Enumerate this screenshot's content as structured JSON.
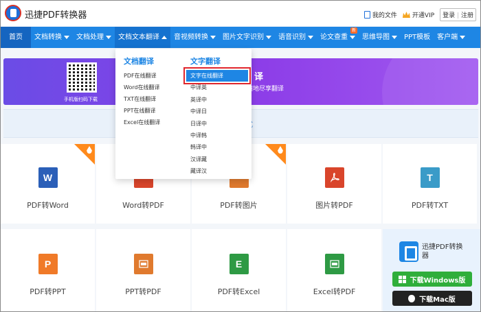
{
  "header": {
    "brand": "迅捷PDF转换器",
    "my_files": "我的文件",
    "vip": "开通VIP",
    "login": "登录",
    "separator": "|",
    "register": "注册"
  },
  "nav": {
    "items": [
      {
        "label": "首页"
      },
      {
        "label": "文档转换"
      },
      {
        "label": "文档处理"
      },
      {
        "label": "文档文本翻译"
      },
      {
        "label": "音视频转换"
      },
      {
        "label": "图片文字识别"
      },
      {
        "label": "语音识别"
      },
      {
        "label": "论文查重",
        "badge": "新"
      },
      {
        "label": "思维导图"
      },
      {
        "label": "PPT模板"
      },
      {
        "label": "客户端"
      }
    ]
  },
  "banner": {
    "qr_caption": "手机版扫码下载",
    "title_fragment": "译",
    "subtitle_fragment": "时随地尽享翻译"
  },
  "strip": {
    "text_fragment": "格式"
  },
  "dropdown": {
    "left_title": "文档翻译",
    "left_items": [
      "PDF在线翻译",
      "Word在线翻译",
      "TXT在线翻译",
      "PPT在线翻译",
      "Excel在线翻译"
    ],
    "right_title": "文字翻译",
    "right_items": [
      "文字在线翻译",
      "中译英",
      "英译中",
      "中译日",
      "日译中",
      "中译韩",
      "韩译中",
      "汉译藏",
      "藏译汉"
    ],
    "selected": "文字在线翻译"
  },
  "tools": {
    "row1": [
      {
        "label": "PDF转Word",
        "icon": "W",
        "color": "#2b5fb8",
        "hot": true
      },
      {
        "label": "Word转PDF",
        "icon": "",
        "color": "#d9452b",
        "hot": true
      },
      {
        "label": "PDF转图片",
        "icon": "",
        "color": "#e07a2e",
        "hot": true
      },
      {
        "label": "图片转PDF",
        "icon": "",
        "color": "#d9452b",
        "hot": false
      },
      {
        "label": "PDF转TXT",
        "icon": "T",
        "color": "#3a9bc8",
        "hot": false
      }
    ],
    "row2": [
      {
        "label": "PDF转PPT",
        "icon": "P",
        "color": "#f07a28"
      },
      {
        "label": "PPT转PDF",
        "icon": "",
        "color": "#e07a2e"
      },
      {
        "label": "PDF转Excel",
        "icon": "E",
        "color": "#2e9a44"
      },
      {
        "label": "Excel转PDF",
        "icon": "",
        "color": "#2e9a44"
      }
    ]
  },
  "promo": {
    "name": "迅捷PDF转换器",
    "windows_button": "下载Windows版",
    "mac_button": "下载Mac版"
  }
}
